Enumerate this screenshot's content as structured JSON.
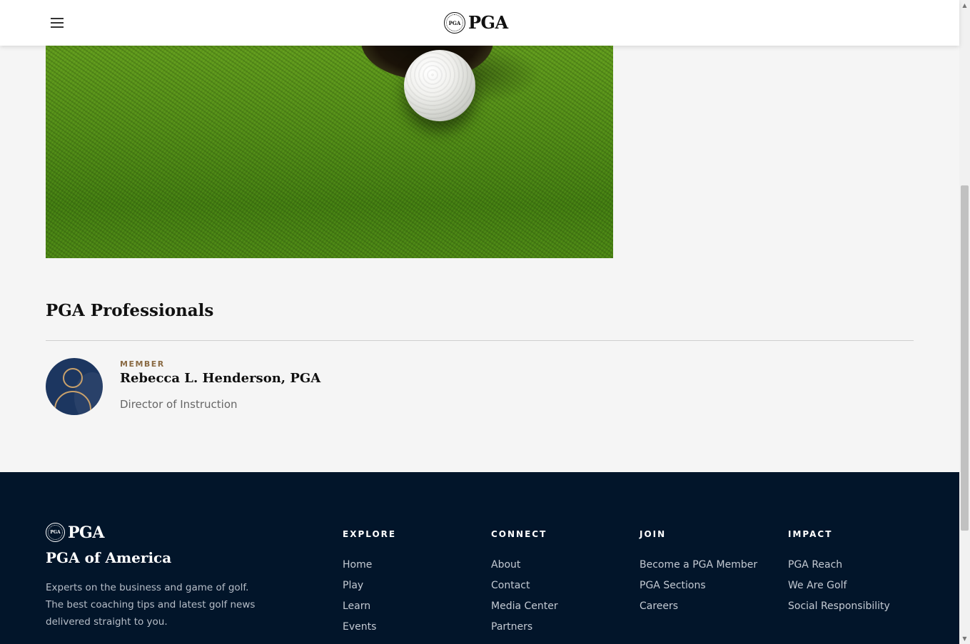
{
  "header": {
    "menu_icon": "hamburger-menu-icon",
    "logo": {
      "seal_text": "PGA",
      "wordmark": "PGA"
    }
  },
  "hero": {
    "alt": "golf-ball-near-hole-image"
  },
  "pros": {
    "title": "PGA Professionals",
    "items": [
      {
        "badge": "MEMBER",
        "name": "Rebecca L. Henderson, PGA",
        "role": "Director of Instruction"
      }
    ]
  },
  "footer": {
    "logo": {
      "seal_text": "PGA",
      "wordmark": "PGA"
    },
    "org_name": "PGA of America",
    "description": "Experts on the business and game of golf. The best coaching tips and latest golf news delivered straight to you.",
    "columns": [
      {
        "heading": "EXPLORE",
        "links": [
          "Home",
          "Play",
          "Learn",
          "Events"
        ]
      },
      {
        "heading": "CONNECT",
        "links": [
          "About",
          "Contact",
          "Media Center",
          "Partners"
        ]
      },
      {
        "heading": "JOIN",
        "links": [
          "Become a PGA Member",
          "PGA Sections",
          "Careers"
        ]
      },
      {
        "heading": "IMPACT",
        "links": [
          "PGA Reach",
          "We Are Golf",
          "Social Responsibility"
        ]
      }
    ]
  },
  "colors": {
    "footer_bg": "#02152a",
    "accent_gold": "#8a6a43",
    "avatar_bg": "#1c3660"
  }
}
